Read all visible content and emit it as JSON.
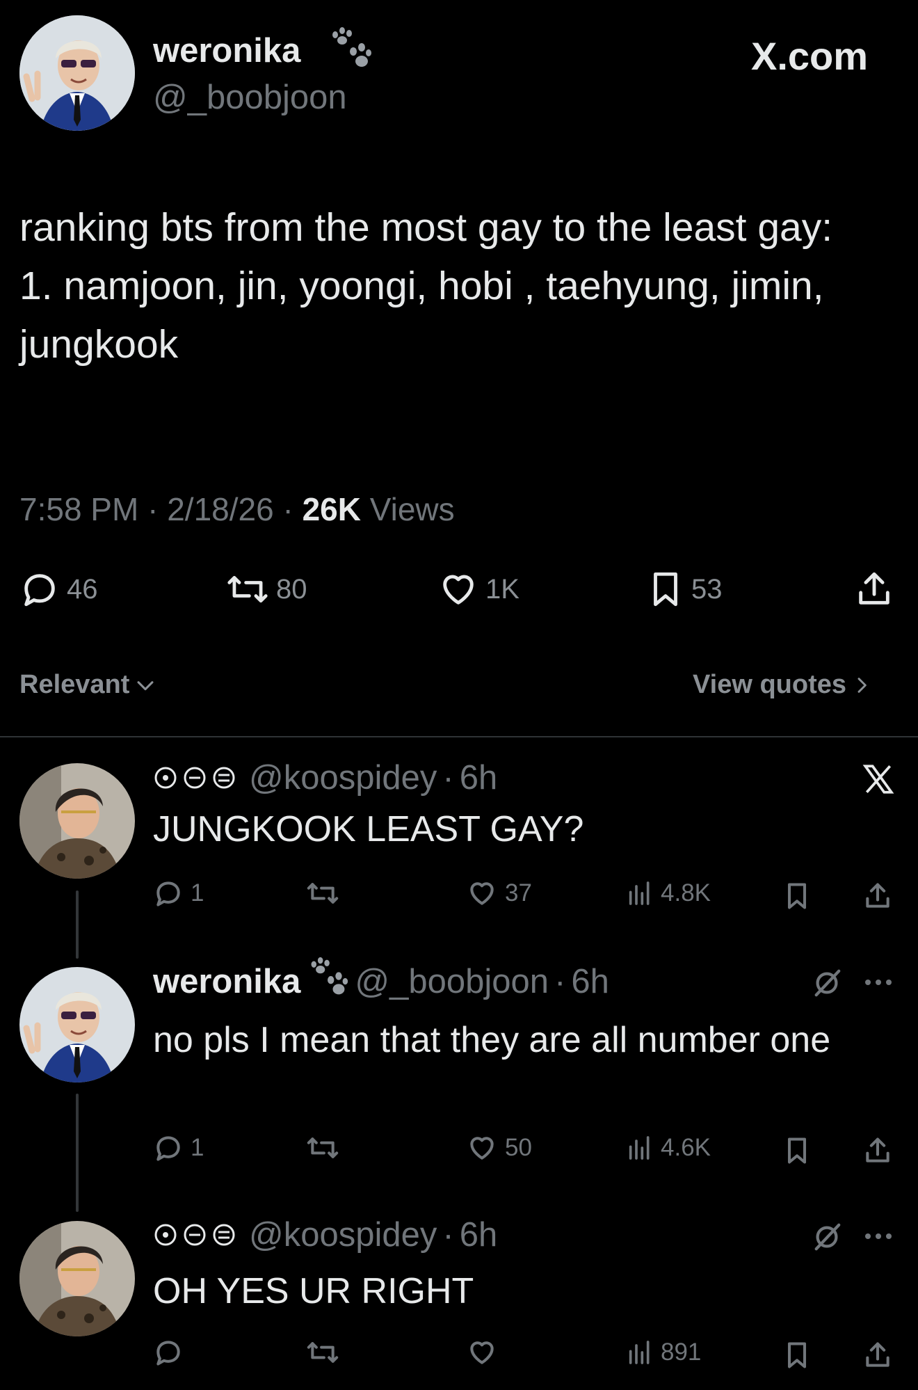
{
  "main_tweet": {
    "author_name": "weronika",
    "handle": "@_boobjoon",
    "site_label": "X.com",
    "text": "ranking bts from the most gay to the least gay:\n1. namjoon, jin, yoongi, hobi , taehyung, jimin, jungkook",
    "time": "7:58 PM",
    "date": "2/18/26",
    "views_count": "26K",
    "views_label": "Views",
    "sep": "·",
    "replies": "46",
    "reposts": "80",
    "likes": "1K",
    "bookmarks": "53"
  },
  "sort": {
    "label": "Relevant",
    "view_quotes": "View quotes"
  },
  "replies": [
    {
      "handle": "@koospidey",
      "time": "6h",
      "text": "JUNGKOOK LEAST GAY?",
      "replies": "1",
      "reposts": "",
      "likes": "37",
      "views": "4.8K"
    },
    {
      "author_name": "weronika",
      "handle": "@_boobjoon",
      "time": "6h",
      "text": "no pls I mean that they are all number one",
      "replies": "1",
      "reposts": "",
      "likes": "50",
      "views": "4.6K"
    },
    {
      "handle": "@koospidey",
      "time": "6h",
      "text": "OH YES UR RIGHT",
      "replies": "",
      "reposts": "",
      "likes": "",
      "views": "891"
    }
  ],
  "colors": {
    "background": "#000000",
    "text": "#e7e9ea",
    "muted": "#71767b",
    "divider": "#2f3336"
  }
}
